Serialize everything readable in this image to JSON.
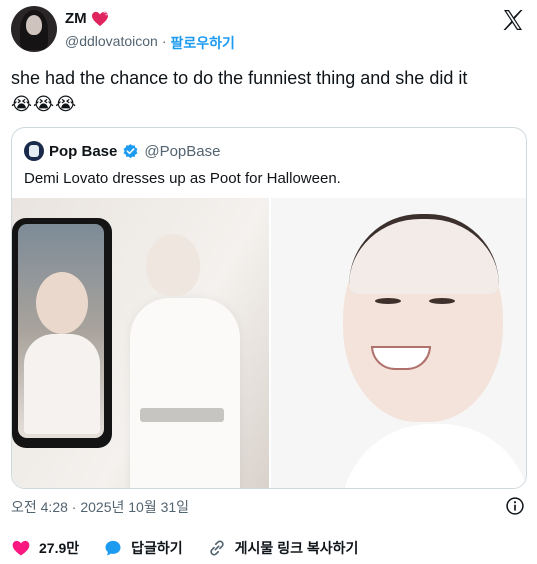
{
  "author": {
    "name": "ZM",
    "handle": "@ddlovatoicon",
    "separator": "·",
    "follow_label": "팔로우하기"
  },
  "tweet": {
    "text": "she had the chance to do the funniest thing and she did it",
    "emojis": "😭😭😭"
  },
  "quote": {
    "name": "Pop Base",
    "handle": "@PopBase",
    "text": "Demi Lovato dresses up as Poot for Halloween."
  },
  "timestamp": "오전 4:28 · 2025년 10월 31일",
  "actions": {
    "like_count": "27.9만",
    "reply_label": "답글하기",
    "copy_link_label": "게시물 링크 복사하기"
  },
  "colors": {
    "accent": "#1d9bf0",
    "like": "#f91880",
    "muted": "#536471"
  },
  "icons": [
    "heart-emoji-icon",
    "x-logo-icon",
    "verified-icon",
    "info-icon",
    "like-icon",
    "reply-icon",
    "link-icon"
  ]
}
